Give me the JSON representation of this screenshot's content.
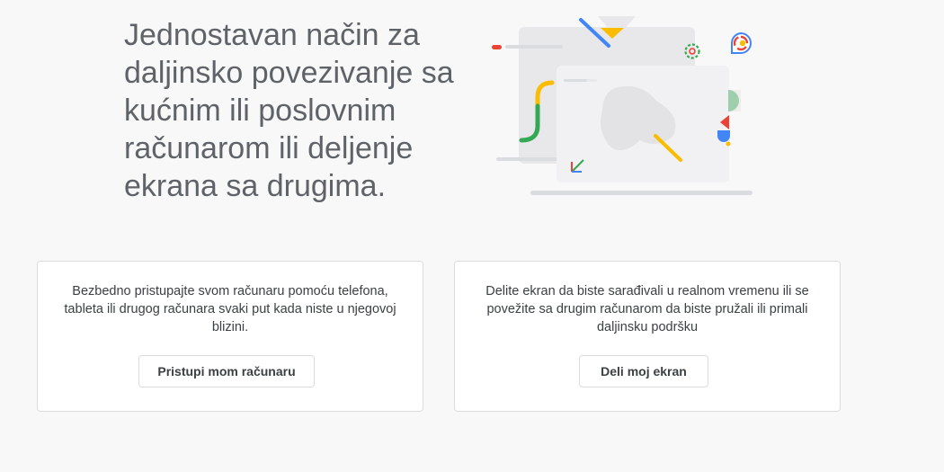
{
  "hero": {
    "title": "Jednostavan način za daljinsko povezivanje sa kućnim ili poslovnim računarom ili deljenje ekrana sa drugima."
  },
  "cards": [
    {
      "description": "Bezbedno pristupajte svom računaru pomoću telefona, tableta ili drugog računara svaki put kada niste u njegovoj blizini.",
      "button_label": "Pristupi mom računaru"
    },
    {
      "description": "Delite ekran da biste sarađivali u realnom vremenu ili se povežite sa drugim računarom da biste pružali ili primali daljinsku podršku",
      "button_label": "Deli moj ekran"
    }
  ],
  "colors": {
    "background": "#f8f8f8",
    "title_text": "#5f6368",
    "body_text": "#3c4043",
    "border": "#dadce0",
    "google_blue": "#4285f4",
    "google_red": "#ea4335",
    "google_yellow": "#fbbc04",
    "google_green": "#34a853"
  }
}
